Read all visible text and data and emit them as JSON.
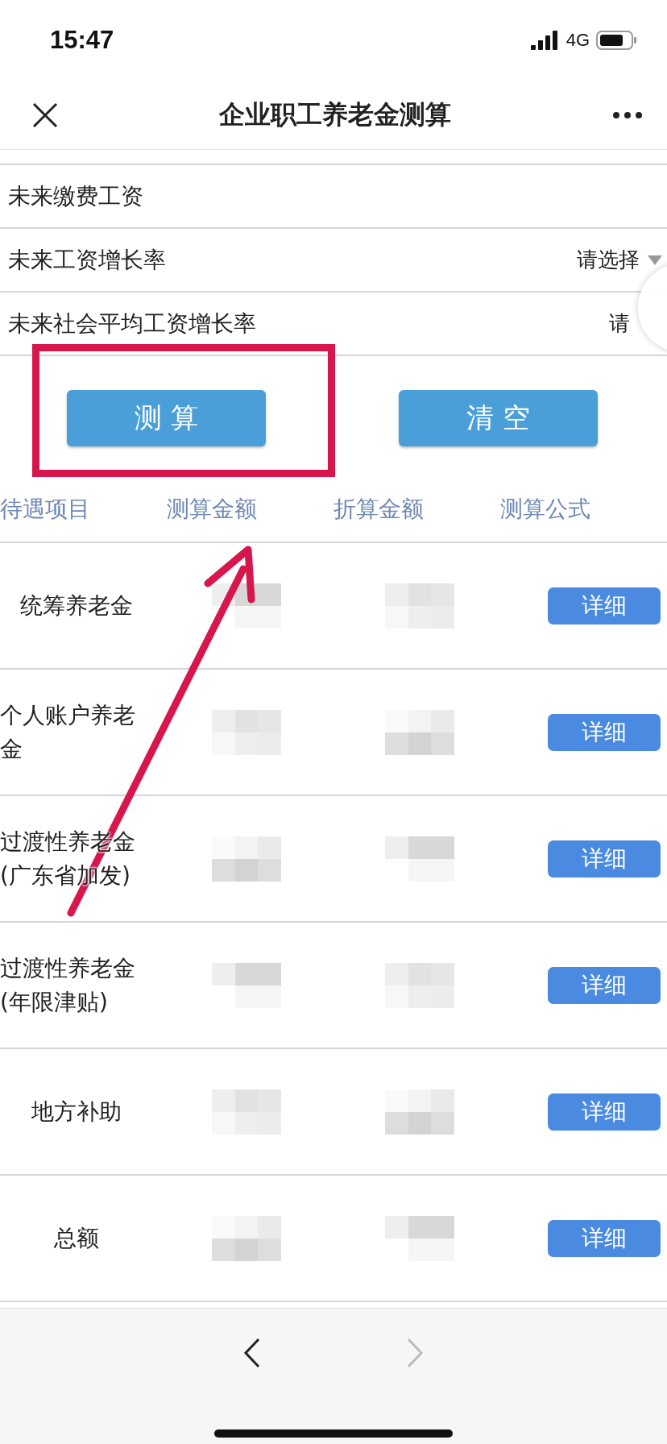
{
  "status_bar": {
    "time": "15:47",
    "network": "4G"
  },
  "nav": {
    "title": "企业职工养老金测算"
  },
  "form": [
    {
      "kind": "input",
      "label": "未来缴费工资"
    },
    {
      "kind": "select",
      "label": "未来工资增长率",
      "value": "请选择",
      "dropdown_arrow": true
    },
    {
      "kind": "select",
      "label": "未来社会平均工资增长率",
      "value": "请",
      "dropdown_arrow": false
    }
  ],
  "buttons": [
    {
      "label": "测 算",
      "highlighted": true
    },
    {
      "label": "清 空",
      "highlighted": false
    }
  ],
  "table": {
    "columns": [
      "待遇项目",
      "测算金额",
      "折算金额",
      "测算公式"
    ],
    "rows": [
      {
        "item": "统筹养老金",
        "action": "详细"
      },
      {
        "item": "个人账户养老金",
        "action": "详细"
      },
      {
        "item": "过渡性养老金\n(广东省加发)",
        "action": "详细"
      },
      {
        "item": "过渡性养老金\n(年限津贴)",
        "action": "详细"
      },
      {
        "item": "地方补助",
        "action": "详细"
      },
      {
        "item": "总额",
        "action": "详细"
      }
    ]
  },
  "annotation": {
    "arrow": true
  }
}
